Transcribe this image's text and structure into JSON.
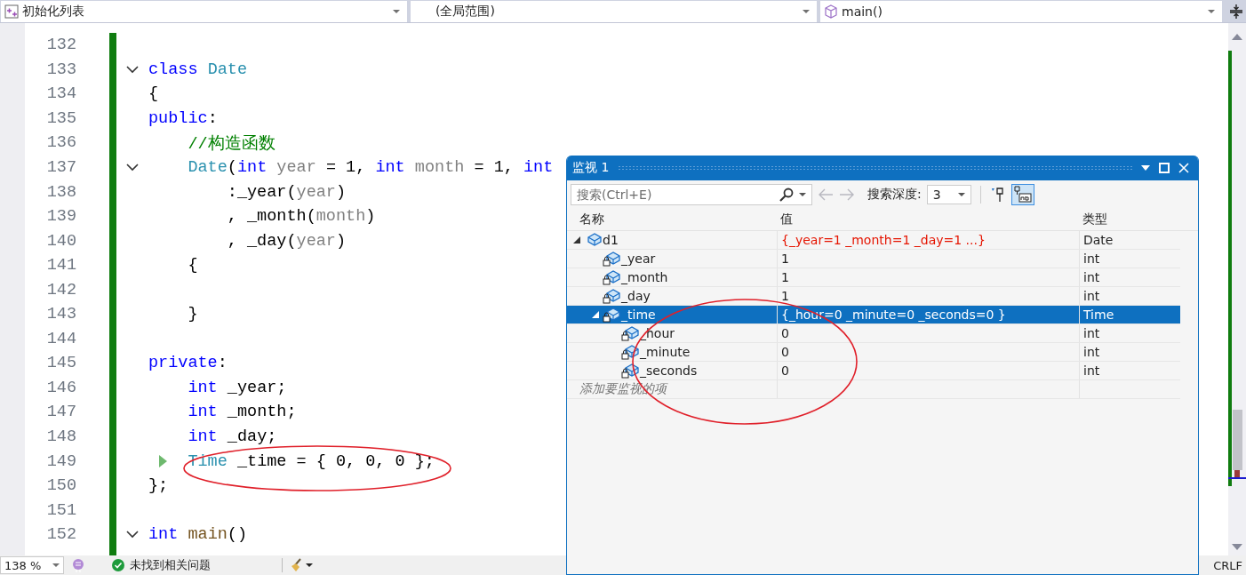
{
  "nav_bar": {
    "project": "初始化列表",
    "scope": "(全局范围)",
    "member": "main()"
  },
  "editor": {
    "lines": [
      {
        "number": "132",
        "fold": false,
        "marker": false
      },
      {
        "number": "133",
        "fold": true,
        "marker": false,
        "tokens": [
          {
            "kind": "kw",
            "text": "class "
          },
          {
            "kind": "type",
            "text": "Date"
          }
        ]
      },
      {
        "number": "134",
        "fold": false,
        "marker": false,
        "tokens": [
          {
            "kind": "plain",
            "text": "{"
          }
        ]
      },
      {
        "number": "135",
        "fold": false,
        "marker": false,
        "tokens": [
          {
            "kind": "kw",
            "text": "public"
          },
          {
            "kind": "plain",
            "text": ":"
          }
        ]
      },
      {
        "number": "136",
        "fold": false,
        "marker": false,
        "tokens": [
          {
            "kind": "comment",
            "text": "    //构造函数"
          }
        ]
      },
      {
        "number": "137",
        "fold": true,
        "marker": false,
        "tokens": [
          {
            "kind": "type",
            "text": "    Date"
          },
          {
            "kind": "plain",
            "text": "("
          },
          {
            "kind": "kw",
            "text": "int "
          },
          {
            "kind": "param",
            "text": "year"
          },
          {
            "kind": "plain",
            "text": " = 1, "
          },
          {
            "kind": "kw",
            "text": "int "
          },
          {
            "kind": "param",
            "text": "month"
          },
          {
            "kind": "plain",
            "text": " = 1, "
          },
          {
            "kind": "kw",
            "text": "int"
          }
        ]
      },
      {
        "number": "138",
        "fold": false,
        "marker": false,
        "tokens": [
          {
            "kind": "plain",
            "text": "        :_year("
          },
          {
            "kind": "param",
            "text": "year"
          },
          {
            "kind": "plain",
            "text": ")"
          }
        ]
      },
      {
        "number": "139",
        "fold": false,
        "marker": false,
        "tokens": [
          {
            "kind": "plain",
            "text": "        , _month("
          },
          {
            "kind": "param",
            "text": "month"
          },
          {
            "kind": "plain",
            "text": ")"
          }
        ]
      },
      {
        "number": "140",
        "fold": false,
        "marker": false,
        "tokens": [
          {
            "kind": "plain",
            "text": "        , _day("
          },
          {
            "kind": "param",
            "text": "year"
          },
          {
            "kind": "plain",
            "text": ")"
          }
        ]
      },
      {
        "number": "141",
        "fold": false,
        "marker": false,
        "tokens": [
          {
            "kind": "plain",
            "text": "    {"
          }
        ]
      },
      {
        "number": "142",
        "fold": false,
        "marker": false
      },
      {
        "number": "143",
        "fold": false,
        "marker": false,
        "tokens": [
          {
            "kind": "plain",
            "text": "    }"
          }
        ]
      },
      {
        "number": "144",
        "fold": false,
        "marker": false
      },
      {
        "number": "145",
        "fold": false,
        "marker": false,
        "tokens": [
          {
            "kind": "kw",
            "text": "private"
          },
          {
            "kind": "plain",
            "text": ":"
          }
        ]
      },
      {
        "number": "146",
        "fold": false,
        "marker": false,
        "tokens": [
          {
            "kind": "kw",
            "text": "    int"
          },
          {
            "kind": "plain",
            "text": " _year;"
          }
        ]
      },
      {
        "number": "147",
        "fold": false,
        "marker": false,
        "tokens": [
          {
            "kind": "kw",
            "text": "    int"
          },
          {
            "kind": "plain",
            "text": " _month;"
          }
        ]
      },
      {
        "number": "148",
        "fold": false,
        "marker": false,
        "tokens": [
          {
            "kind": "kw",
            "text": "    int"
          },
          {
            "kind": "plain",
            "text": " _day;"
          }
        ]
      },
      {
        "number": "149",
        "fold": false,
        "marker": true,
        "tokens": [
          {
            "kind": "type",
            "text": "    Time"
          },
          {
            "kind": "plain",
            "text": " _time = { 0, 0, 0 };"
          }
        ]
      },
      {
        "number": "150",
        "fold": false,
        "marker": false,
        "tokens": [
          {
            "kind": "plain",
            "text": "};"
          }
        ]
      },
      {
        "number": "151",
        "fold": false,
        "marker": false
      },
      {
        "number": "152",
        "fold": true,
        "marker": false,
        "tokens": [
          {
            "kind": "kw",
            "text": "int "
          },
          {
            "kind": "fn",
            "text": "main"
          },
          {
            "kind": "plain",
            "text": "()"
          }
        ]
      }
    ]
  },
  "status_bar": {
    "zoom": "138 %",
    "issues": "未找到相关问题",
    "line_ending": "CRLF"
  },
  "watch": {
    "title": "监视 1",
    "search_placeholder": "搜索(Ctrl+E)",
    "depth_label": "搜索深度:",
    "depth": "3",
    "columns": [
      "名称",
      "值",
      "类型"
    ],
    "rows": [
      {
        "name": "d1",
        "value": "{_year=1 _month=1 _day=1 ...}",
        "type": "Date",
        "expanded": true,
        "selected": false,
        "changed": true,
        "children": [
          {
            "name": "_year",
            "value": "1",
            "type": "int",
            "selected": false,
            "changed": false
          },
          {
            "name": "_month",
            "value": "1",
            "type": "int",
            "selected": false,
            "changed": false
          },
          {
            "name": "_day",
            "value": "1",
            "type": "int",
            "selected": false,
            "changed": false
          },
          {
            "name": "_time",
            "value": "{_hour=0 _minute=0 _seconds=0 }",
            "type": "Time",
            "expanded": true,
            "selected": true,
            "changed": false,
            "children": [
              {
                "name": "_hour",
                "value": "0",
                "type": "int",
                "selected": false,
                "changed": false
              },
              {
                "name": "_minute",
                "value": "0",
                "type": "int",
                "selected": false,
                "changed": false
              },
              {
                "name": "_seconds",
                "value": "0",
                "type": "int",
                "selected": false,
                "changed": false
              }
            ]
          }
        ]
      }
    ],
    "add_placeholder": "添加要监视的项"
  }
}
